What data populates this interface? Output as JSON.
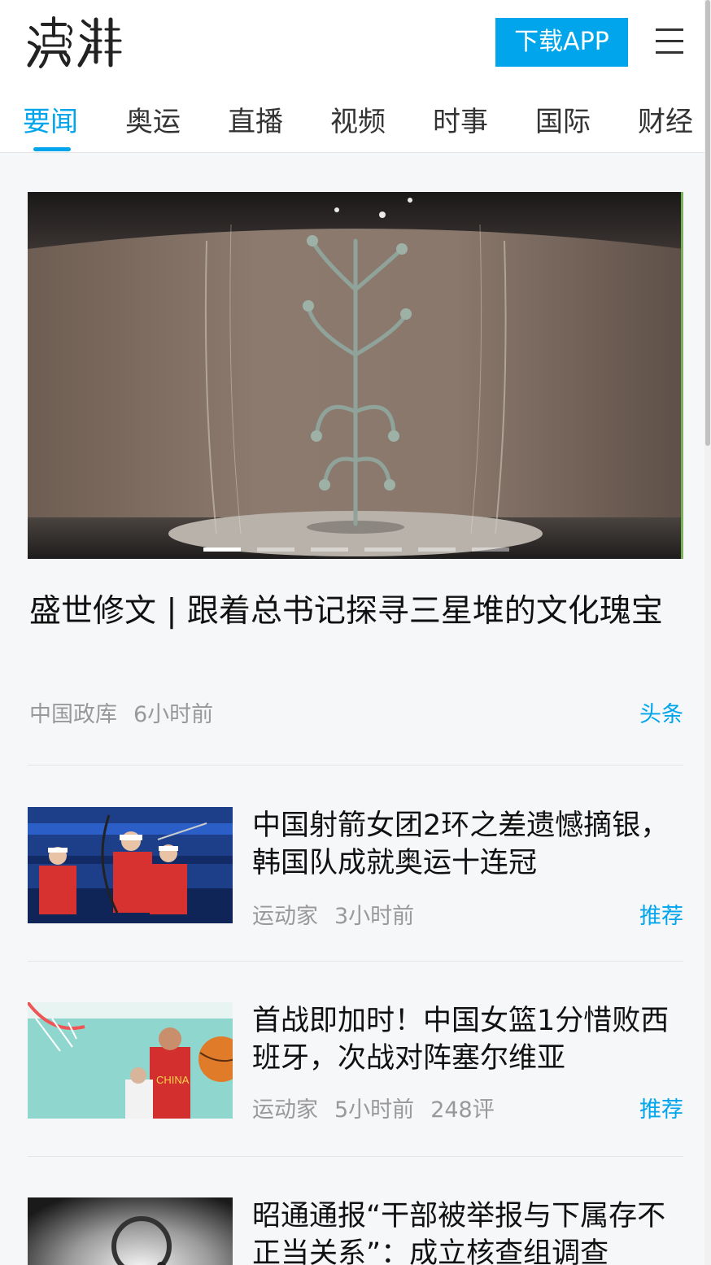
{
  "header": {
    "logo_text": "澎湃",
    "download_label": "下载APP",
    "menu_icon": "menu-icon"
  },
  "tabs": [
    {
      "label": "要闻",
      "active": true
    },
    {
      "label": "奥运"
    },
    {
      "label": "直播"
    },
    {
      "label": "视频"
    },
    {
      "label": "时事"
    },
    {
      "label": "国际"
    },
    {
      "label": "财经"
    }
  ],
  "hero": {
    "title": "盛世修文 | 跟着总书记探寻三星堆的文化瑰宝",
    "source": "中国政库",
    "time": "6小时前",
    "tag": "头条",
    "carousel_total": 6,
    "carousel_active": 1
  },
  "news": [
    {
      "title": "中国射箭女团2环之差遗憾摘银，韩国队成就奥运十连冠",
      "source": "运动家",
      "time": "3小时前",
      "comments": "",
      "tag": "推荐"
    },
    {
      "title": "首战即加时！中国女篮1分惜败西班牙，次战对阵塞尔维亚",
      "source": "运动家",
      "time": "5小时前",
      "comments": "248评",
      "tag": "推荐"
    },
    {
      "title": "昭通通报“干部被举报与下属存不正当关系”：成立核查组调查",
      "source": "",
      "time": "",
      "comments": "",
      "tag": ""
    }
  ],
  "colors": {
    "accent": "#00a5eb",
    "meta": "#999999",
    "background": "#f6f7f9"
  }
}
